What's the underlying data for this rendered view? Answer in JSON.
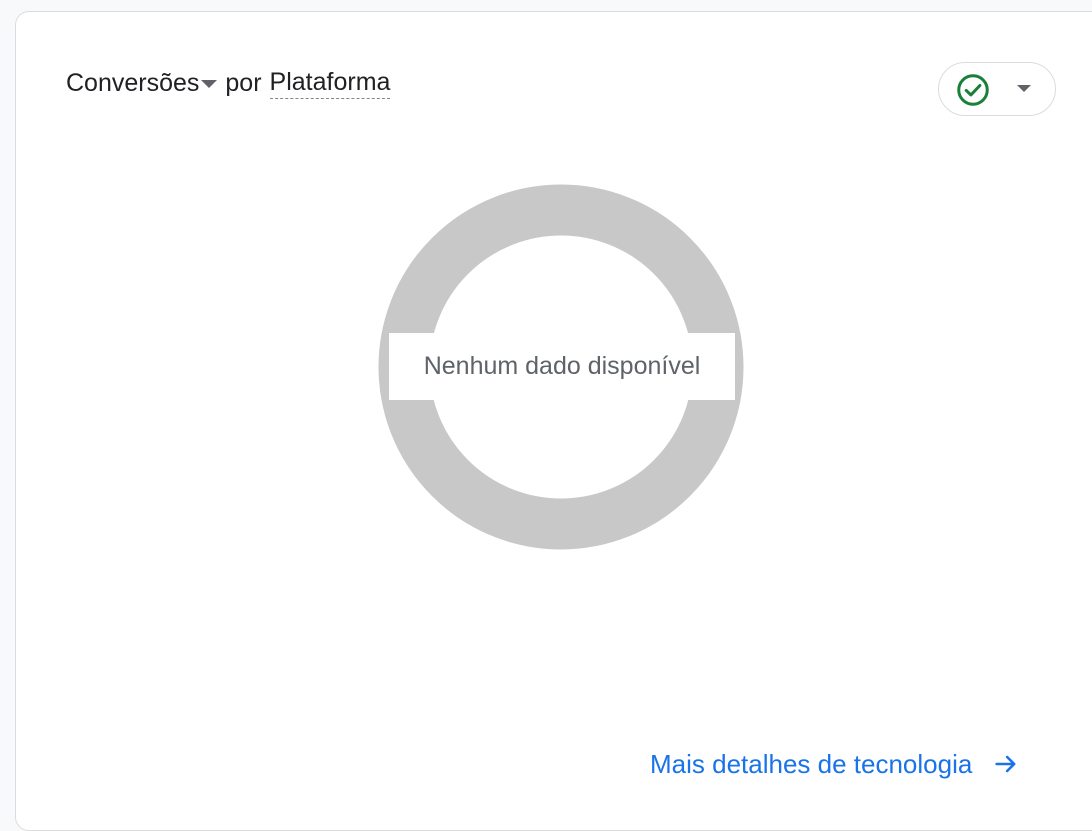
{
  "card": {
    "title": {
      "metric_label": "Conversões",
      "connector": "por",
      "dimension_label": "Plataforma"
    },
    "status_button": {
      "icon": "check-circle-icon",
      "dropdown_icon": "caret-down-icon",
      "status_color": "#188038"
    },
    "chart": {
      "no_data_text": "Nenhum dado disponível"
    },
    "footer": {
      "link_label": "Mais detalhes de tecnologia",
      "link_icon": "arrow-right-icon"
    }
  },
  "colors": {
    "accent": "#1a73e8",
    "empty_ring": "#c8c8c8",
    "success": "#188038"
  },
  "chart_data": {
    "type": "pie",
    "categories": [],
    "values": [],
    "title": "Conversões por Plataforma"
  }
}
